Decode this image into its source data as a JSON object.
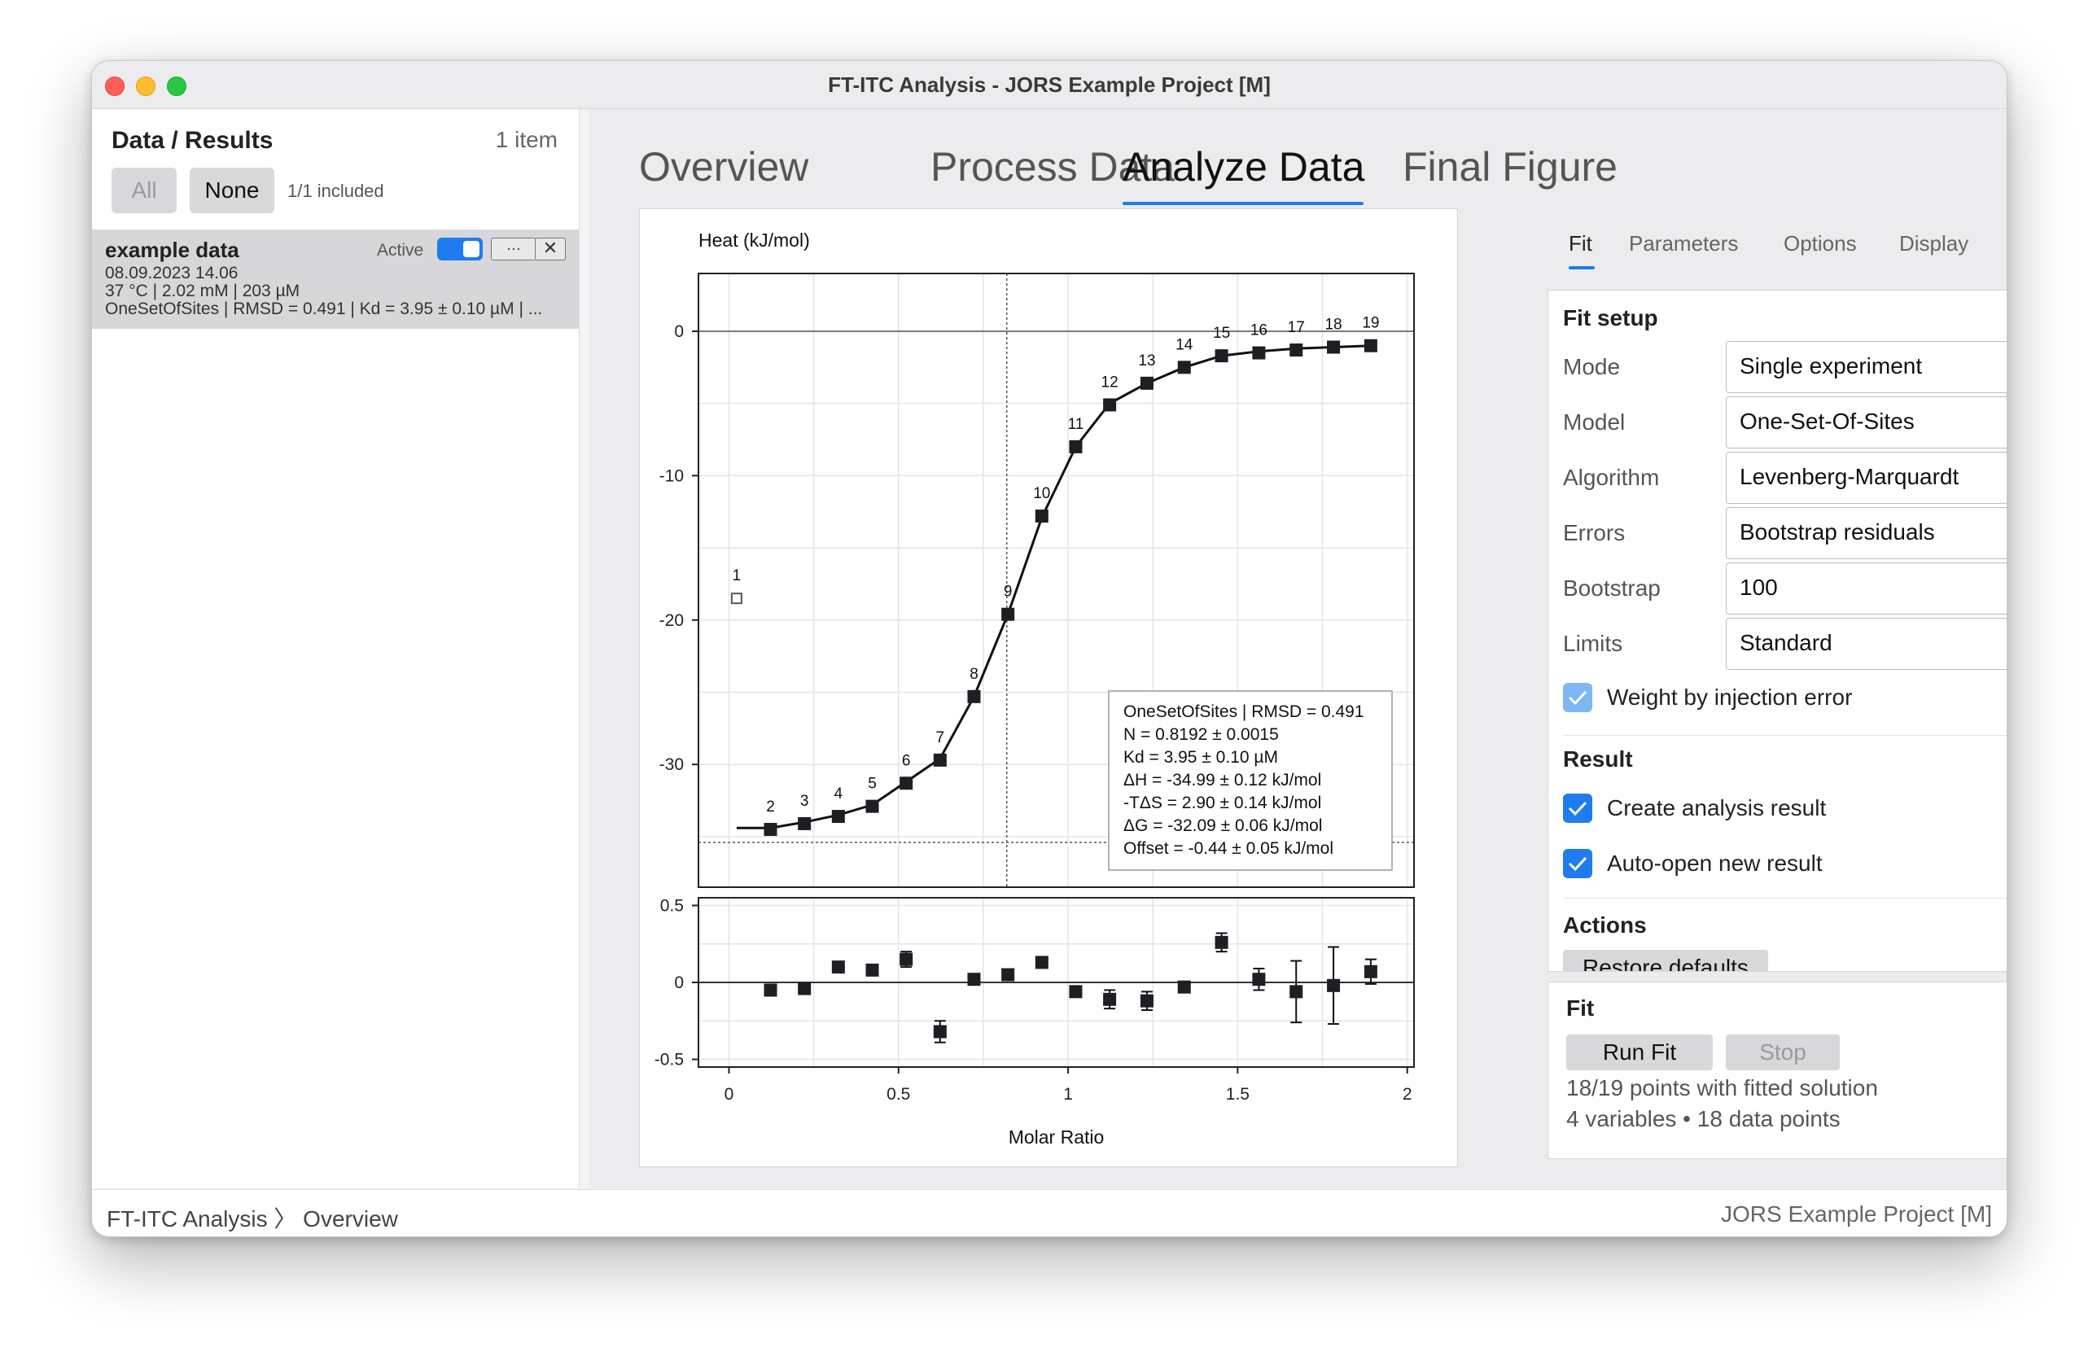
{
  "window": {
    "title": "FT-ITC Analysis - JORS Example Project [M]"
  },
  "sidebar": {
    "title": "Data / Results",
    "count": "1 item",
    "btn_all": "All",
    "btn_none": "None",
    "included": "1/1 included",
    "item": {
      "name": "example data",
      "active_label": "Active",
      "more": "···",
      "close": "✕",
      "date": "08.09.2023 14.06",
      "conditions": "37 °C | 2.02 mM | 203 µM",
      "summary": "OneSetOfSites | RMSD = 0.491 | Kd = 3.95 ± 0.10 µM | ..."
    }
  },
  "tabs": [
    "Overview",
    "Process Data",
    "Analyze Data",
    "Final Figure"
  ],
  "active_tab": "Analyze Data",
  "chart_data": {
    "type": "scatter",
    "top": {
      "ylabel": "Heat (kJ/mol)",
      "ylim": [
        -38.5,
        4
      ],
      "yticks": [
        0,
        -10,
        -20,
        -30
      ],
      "ytick_labels": [
        "0",
        "-10",
        "-20",
        "-30"
      ],
      "points": {
        "x": [
          0.0225,
          0.1225,
          0.2225,
          0.3225,
          0.4225,
          0.5225,
          0.6225,
          0.7225,
          0.8225,
          0.9225,
          1.0225,
          1.1225,
          1.2325,
          1.3425,
          1.4525,
          1.5625,
          1.6725,
          1.7825,
          1.8925
        ],
        "y": [
          -18.5,
          -34.5,
          -34.1,
          -33.6,
          -32.9,
          -31.3,
          -29.7,
          -25.3,
          -19.6,
          -12.8,
          -8.0,
          -5.1,
          -3.6,
          -2.5,
          -1.7,
          -1.5,
          -1.3,
          -1.1,
          -1.0
        ],
        "labels": [
          "1",
          "2",
          "3",
          "4",
          "5",
          "6",
          "7",
          "8",
          "9",
          "10",
          "11",
          "12",
          "13",
          "14",
          "15",
          "16",
          "17",
          "18",
          "19"
        ],
        "excluded": [
          0
        ]
      },
      "fit_line": {
        "x": [
          0.0225,
          0.1225,
          0.2225,
          0.3225,
          0.4225,
          0.5225,
          0.6225,
          0.7225,
          0.8225,
          0.9225,
          1.0225,
          1.1225,
          1.2325,
          1.3425,
          1.4525,
          1.5625,
          1.6725,
          1.7825,
          1.8925
        ],
        "y": [
          -34.4,
          -34.4,
          -34.0,
          -33.5,
          -32.8,
          -31.2,
          -29.6,
          -25.3,
          -19.6,
          -12.9,
          -8.0,
          -5.0,
          -3.6,
          -2.5,
          -1.7,
          -1.4,
          -1.2,
          -1.1,
          -1.0
        ]
      },
      "ref_lines": {
        "vertical_x": 0.8192,
        "horizontal_y": -35.4
      },
      "annotation": [
        "OneSetOfSites | RMSD = 0.491",
        "N = 0.8192 ± 0.0015",
        "Kd = 3.95 ± 0.10 µM",
        "ΔH = -34.99 ± 0.12 kJ/mol",
        "-TΔS = 2.90 ± 0.14 kJ/mol",
        "ΔG = -32.09 ± 0.06 kJ/mol",
        "Offset = -0.44 ± 0.05 kJ/mol"
      ]
    },
    "bottom": {
      "ylim": [
        -0.55,
        0.55
      ],
      "yticks": [
        0.5,
        0,
        -0.5
      ],
      "ytick_labels": [
        "0.5",
        "0",
        "-0.5"
      ],
      "x": [
        0.1225,
        0.2225,
        0.3225,
        0.4225,
        0.5225,
        0.6225,
        0.7225,
        0.8225,
        0.9225,
        1.0225,
        1.1225,
        1.2325,
        1.3425,
        1.4525,
        1.5625,
        1.6725,
        1.7825,
        1.8925
      ],
      "y": [
        -0.05,
        -0.04,
        0.1,
        0.08,
        0.15,
        -0.32,
        0.02,
        0.05,
        0.13,
        -0.06,
        -0.11,
        -0.12,
        -0.03,
        0.26,
        0.02,
        -0.06,
        -0.02,
        0.07
      ],
      "err": [
        0.01,
        0.01,
        0.01,
        0.01,
        0.05,
        0.07,
        0.02,
        0.01,
        0.01,
        0.01,
        0.06,
        0.06,
        0.01,
        0.06,
        0.07,
        0.2,
        0.25,
        0.08
      ]
    },
    "xlabel": "Molar Ratio",
    "xlim": [
      -0.09,
      2.02
    ],
    "xticks": [
      0,
      0.5,
      1,
      1.5,
      2
    ],
    "xtick_labels": [
      "0",
      "0.5",
      "1",
      "1.5",
      "2"
    ],
    "grid": true
  },
  "right_tabs": [
    "Fit",
    "Parameters",
    "Options",
    "Display"
  ],
  "fit_setup": {
    "title": "Fit setup",
    "mode": {
      "label": "Mode",
      "value": "Single experiment"
    },
    "model": {
      "label": "Model",
      "value": "One-Set-Of-Sites"
    },
    "algorithm": {
      "label": "Algorithm",
      "value": "Levenberg-Marquardt"
    },
    "errors": {
      "label": "Errors",
      "value": "Bootstrap residuals"
    },
    "bootstrap": {
      "label": "Bootstrap",
      "value": "100"
    },
    "limits": {
      "label": "Limits",
      "value": "Standard"
    },
    "weight_label": "Weight by injection error"
  },
  "result": {
    "title": "Result",
    "create_label": "Create analysis result",
    "autoopen_label": "Auto-open new result"
  },
  "actions": {
    "title": "Actions",
    "restore_label": "Restore defaults"
  },
  "fit": {
    "title": "Fit",
    "run_label": "Run Fit",
    "stop_label": "Stop",
    "status1": "18/19 points with fitted solution",
    "status2": "4 variables • 18 data points"
  },
  "statusbar": {
    "path_app": "FT-ITC Analysis",
    "path_page": "Overview",
    "project": "JORS Example Project [M]"
  },
  "colors": {
    "accent": "#1f7cf0",
    "checkbox_disabled": "#7db7f5"
  }
}
